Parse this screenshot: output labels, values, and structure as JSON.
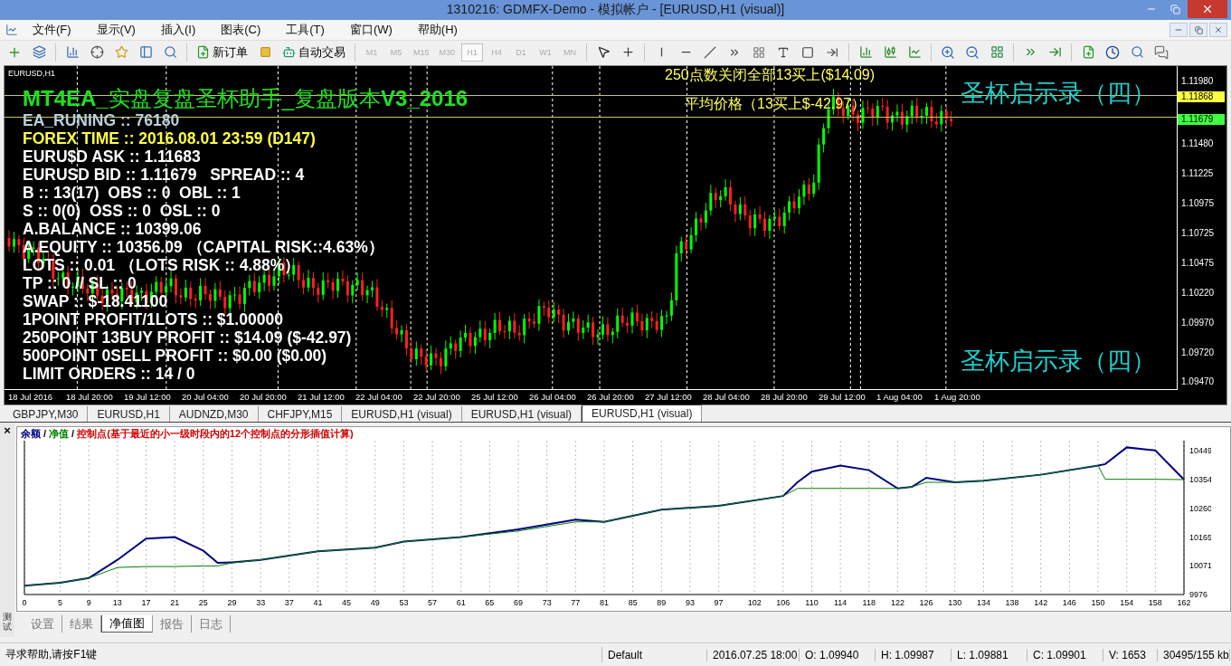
{
  "window": {
    "title": "1310216: GDMFX-Demo - 模拟帐户 - [EURUSD,H1 (visual)]"
  },
  "menu": [
    "文件(F)",
    "显示(V)",
    "插入(I)",
    "图表(C)",
    "工具(T)",
    "窗口(W)",
    "帮助(H)"
  ],
  "toolbar": {
    "new_order": "新订单",
    "auto_trading": "自动交易",
    "timeframes": [
      {
        "label": "M1",
        "selected": false
      },
      {
        "label": "M5",
        "selected": false
      },
      {
        "label": "M15",
        "selected": false
      },
      {
        "label": "M30",
        "selected": false
      },
      {
        "label": "H1",
        "selected": true
      },
      {
        "label": "H4",
        "selected": false
      },
      {
        "label": "D1",
        "selected": false
      },
      {
        "label": "W1",
        "selected": false
      },
      {
        "label": "MN",
        "selected": false
      }
    ]
  },
  "chart": {
    "symbol": "EURUSD,H1",
    "headline": "**MT4EA_**实盘复盘圣杯助手_复盘版本**V3_2016**",
    "info_lines": [
      {
        "text": "EA_RUNING :: 76180",
        "color": "#b8d0dc"
      },
      {
        "text": "FOREX TIME :: 2016.08.01 23:59 (D147)",
        "color": "#ffff40"
      },
      {
        "text": "EURU$D ASK :: 1.11683",
        "color": "#ffffff"
      },
      {
        "text": "EURUSD BID :: 1.11679   SPREAD :: 4",
        "color": "#ffffff"
      },
      {
        "text": "B :: 13(17)  OBS :: 0  OBL :: 1",
        "color": "#ffffff"
      },
      {
        "text": "S :: 0(0)  OSS :: 0  OSL :: 0",
        "color": "#ffffff"
      },
      {
        "text": "A.BALANCE :: 10399.06",
        "color": "#ffffff"
      },
      {
        "text": "A.EQUITY :: 10356.09 （CAPITAL RISK::4.63%）",
        "color": "#ffffff"
      },
      {
        "text": "LOTS :: 0.01 （LOTS RISK :: 4.88%）",
        "color": "#ffffff"
      },
      {
        "text": "TP :: 0 // SL :: 0",
        "color": "#ffffff"
      },
      {
        "text": "SWAP :: $-18.41100",
        "color": "#ffffff"
      },
      {
        "text": "1POINT PROFIT/1LOTS :: $1.00000",
        "color": "#ffffff"
      },
      {
        "text": "250POINT 13BUY PROFIT :: $14.09 ($-42.97)",
        "color": "#ffffff"
      },
      {
        "text": "500POINT 0SELL PROFIT :: $0.00 ($0.00)",
        "color": "#ffffff"
      },
      {
        "text": "LIMIT ORDERS :: 14 / 0",
        "color": "#ffffff"
      }
    ],
    "close_all_note": "250点数关闭全部13买上($14.09)",
    "average_note": "平均价格（13买上$-42.97）",
    "top_caption": "圣杯启示录（四）",
    "bottom_caption": "圣杯启示录（四）",
    "price_labels": [
      {
        "text": "1.11980",
        "kind": "tick"
      },
      {
        "text": "1.11868",
        "kind": "target"
      },
      {
        "text": "1.11679",
        "kind": "bid"
      },
      {
        "text": "1.11480",
        "kind": "tick"
      },
      {
        "text": "1.11225",
        "kind": "tick"
      },
      {
        "text": "1.10975",
        "kind": "tick"
      },
      {
        "text": "1.10725",
        "kind": "tick"
      },
      {
        "text": "1.10475",
        "kind": "tick"
      },
      {
        "text": "1.10220",
        "kind": "tick"
      },
      {
        "text": "1.09970",
        "kind": "tick"
      },
      {
        "text": "1.09720",
        "kind": "tick"
      },
      {
        "text": "1.09470",
        "kind": "tick"
      }
    ],
    "time_labels": [
      "18 Jul 2016",
      "18 Jul 20:00",
      "19 Jul 12:00",
      "20 Jul 04:00",
      "20 Jul 20:00",
      "21 Jul 12:00",
      "22 Jul 04:00",
      "22 Jul 20:00",
      "25 Jul 12:00",
      "26 Jul 04:00",
      "26 Jul 20:00",
      "27 Jul 12:00",
      "28 Jul 04:00",
      "28 Jul 20:00",
      "29 Jul 12:00",
      "1 Aug 04:00",
      "1 Aug 20:00"
    ]
  },
  "chart_tabs": [
    {
      "label": "GBPJPY,M30",
      "selected": false
    },
    {
      "label": "EURUSD,H1",
      "selected": false
    },
    {
      "label": "AUDNZD,M30",
      "selected": false
    },
    {
      "label": "CHFJPY,M15",
      "selected": false
    },
    {
      "label": "EURUSD,H1 (visual)",
      "selected": false
    },
    {
      "label": "EURUSD,H1 (visual)",
      "selected": false
    },
    {
      "label": "EURUSD,H1 (visual)",
      "selected": true
    }
  ],
  "tester": {
    "close": "×",
    "side_label": "测试",
    "legend_separators": [
      "/",
      "/"
    ],
    "control_points": {
      "text": "控制点(基于最近的小一级时段内的12个控制点的分形插值计算)",
      "color": "#d00000"
    },
    "chart_data": {
      "type": "line",
      "x": [
        0,
        5,
        9,
        13,
        17,
        21,
        25,
        27,
        29,
        33,
        41,
        49,
        53,
        61,
        69,
        77,
        81,
        89,
        97,
        106,
        108,
        110,
        114,
        118,
        122,
        124,
        126,
        130,
        134,
        142,
        150,
        151,
        154,
        158,
        162
      ],
      "series": [
        {
          "name": "余额",
          "color": "#000080",
          "values": [
            10005,
            10015,
            10030,
            10090,
            10160,
            10165,
            10120,
            10080,
            10082,
            10090,
            10118,
            10130,
            10150,
            10165,
            10190,
            10222,
            10215,
            10255,
            10268,
            10300,
            10345,
            10380,
            10400,
            10385,
            10325,
            10330,
            10360,
            10345,
            10350,
            10370,
            10400,
            10405,
            10460,
            10450,
            10354
          ]
        },
        {
          "name": "净值",
          "color": "#008000",
          "values": [
            10005,
            10015,
            10030,
            10065,
            10068,
            10068,
            10070,
            10070,
            10080,
            10090,
            10118,
            10130,
            10150,
            10165,
            10185,
            10215,
            10215,
            10255,
            10268,
            10300,
            10325,
            10325,
            10325,
            10325,
            10325,
            10330,
            10345,
            10345,
            10350,
            10370,
            10400,
            10355,
            10355,
            10355,
            10354
          ]
        }
      ],
      "xlim": [
        0,
        162
      ],
      "ylim": [
        9976,
        10482
      ],
      "grid": true,
      "xticks": [
        0,
        5,
        9,
        13,
        17,
        21,
        25,
        29,
        33,
        37,
        41,
        45,
        49,
        53,
        57,
        61,
        65,
        69,
        73,
        77,
        81,
        85,
        89,
        93,
        97,
        102,
        106,
        110,
        114,
        118,
        122,
        126,
        130,
        134,
        138,
        142,
        146,
        150,
        154,
        158,
        162
      ],
      "yticks": [
        9976,
        10071,
        10165,
        10260,
        10354,
        10449
      ]
    },
    "tabs": [
      {
        "label": "设置",
        "selected": false
      },
      {
        "label": "结果",
        "selected": false
      },
      {
        "label": "净值图",
        "selected": true
      },
      {
        "label": "报告",
        "selected": false
      },
      {
        "label": "日志",
        "selected": false
      }
    ]
  },
  "status_bar": {
    "help": "寻求帮助,请按F1键",
    "profile": "Default",
    "time": "2016.07.25 18:00",
    "open": "O: 1.09940",
    "high": "H: 1.09987",
    "low": "L: 1.09881",
    "close": "C: 1.09901",
    "volume": "V: 1653",
    "traffic": "30495/155 kb"
  }
}
